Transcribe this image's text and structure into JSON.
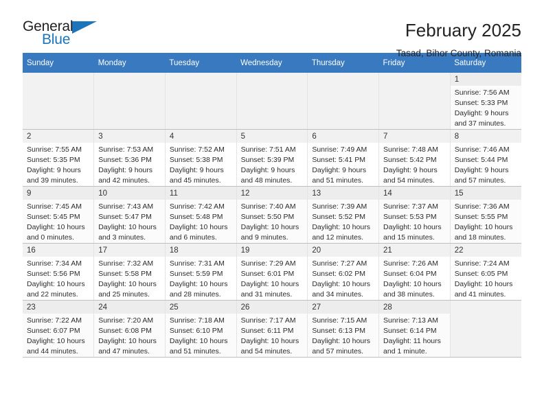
{
  "brand": {
    "name_part1": "General",
    "name_part2": "Blue",
    "triangle_icon": "triangle-icon",
    "colors": {
      "blue": "#1c74bb",
      "dark": "#231f20"
    }
  },
  "header": {
    "title": "February 2025",
    "subtitle": "Tasad, Bihor County, Romania"
  },
  "calendar": {
    "header_bg": "#3879bf",
    "weekdays": [
      "Sunday",
      "Monday",
      "Tuesday",
      "Wednesday",
      "Thursday",
      "Friday",
      "Saturday"
    ],
    "weeks": [
      [
        {
          "day": "",
          "empty": true
        },
        {
          "day": "",
          "empty": true
        },
        {
          "day": "",
          "empty": true
        },
        {
          "day": "",
          "empty": true
        },
        {
          "day": "",
          "empty": true
        },
        {
          "day": "",
          "empty": true
        },
        {
          "day": "1",
          "sunrise": "Sunrise: 7:56 AM",
          "sunset": "Sunset: 5:33 PM",
          "daylight1": "Daylight: 9 hours",
          "daylight2": "and 37 minutes."
        }
      ],
      [
        {
          "day": "2",
          "sunrise": "Sunrise: 7:55 AM",
          "sunset": "Sunset: 5:35 PM",
          "daylight1": "Daylight: 9 hours",
          "daylight2": "and 39 minutes."
        },
        {
          "day": "3",
          "sunrise": "Sunrise: 7:53 AM",
          "sunset": "Sunset: 5:36 PM",
          "daylight1": "Daylight: 9 hours",
          "daylight2": "and 42 minutes."
        },
        {
          "day": "4",
          "sunrise": "Sunrise: 7:52 AM",
          "sunset": "Sunset: 5:38 PM",
          "daylight1": "Daylight: 9 hours",
          "daylight2": "and 45 minutes."
        },
        {
          "day": "5",
          "sunrise": "Sunrise: 7:51 AM",
          "sunset": "Sunset: 5:39 PM",
          "daylight1": "Daylight: 9 hours",
          "daylight2": "and 48 minutes."
        },
        {
          "day": "6",
          "sunrise": "Sunrise: 7:49 AM",
          "sunset": "Sunset: 5:41 PM",
          "daylight1": "Daylight: 9 hours",
          "daylight2": "and 51 minutes."
        },
        {
          "day": "7",
          "sunrise": "Sunrise: 7:48 AM",
          "sunset": "Sunset: 5:42 PM",
          "daylight1": "Daylight: 9 hours",
          "daylight2": "and 54 minutes."
        },
        {
          "day": "8",
          "sunrise": "Sunrise: 7:46 AM",
          "sunset": "Sunset: 5:44 PM",
          "daylight1": "Daylight: 9 hours",
          "daylight2": "and 57 minutes."
        }
      ],
      [
        {
          "day": "9",
          "sunrise": "Sunrise: 7:45 AM",
          "sunset": "Sunset: 5:45 PM",
          "daylight1": "Daylight: 10 hours",
          "daylight2": "and 0 minutes."
        },
        {
          "day": "10",
          "sunrise": "Sunrise: 7:43 AM",
          "sunset": "Sunset: 5:47 PM",
          "daylight1": "Daylight: 10 hours",
          "daylight2": "and 3 minutes."
        },
        {
          "day": "11",
          "sunrise": "Sunrise: 7:42 AM",
          "sunset": "Sunset: 5:48 PM",
          "daylight1": "Daylight: 10 hours",
          "daylight2": "and 6 minutes."
        },
        {
          "day": "12",
          "sunrise": "Sunrise: 7:40 AM",
          "sunset": "Sunset: 5:50 PM",
          "daylight1": "Daylight: 10 hours",
          "daylight2": "and 9 minutes."
        },
        {
          "day": "13",
          "sunrise": "Sunrise: 7:39 AM",
          "sunset": "Sunset: 5:52 PM",
          "daylight1": "Daylight: 10 hours",
          "daylight2": "and 12 minutes."
        },
        {
          "day": "14",
          "sunrise": "Sunrise: 7:37 AM",
          "sunset": "Sunset: 5:53 PM",
          "daylight1": "Daylight: 10 hours",
          "daylight2": "and 15 minutes."
        },
        {
          "day": "15",
          "sunrise": "Sunrise: 7:36 AM",
          "sunset": "Sunset: 5:55 PM",
          "daylight1": "Daylight: 10 hours",
          "daylight2": "and 18 minutes."
        }
      ],
      [
        {
          "day": "16",
          "sunrise": "Sunrise: 7:34 AM",
          "sunset": "Sunset: 5:56 PM",
          "daylight1": "Daylight: 10 hours",
          "daylight2": "and 22 minutes."
        },
        {
          "day": "17",
          "sunrise": "Sunrise: 7:32 AM",
          "sunset": "Sunset: 5:58 PM",
          "daylight1": "Daylight: 10 hours",
          "daylight2": "and 25 minutes."
        },
        {
          "day": "18",
          "sunrise": "Sunrise: 7:31 AM",
          "sunset": "Sunset: 5:59 PM",
          "daylight1": "Daylight: 10 hours",
          "daylight2": "and 28 minutes."
        },
        {
          "day": "19",
          "sunrise": "Sunrise: 7:29 AM",
          "sunset": "Sunset: 6:01 PM",
          "daylight1": "Daylight: 10 hours",
          "daylight2": "and 31 minutes."
        },
        {
          "day": "20",
          "sunrise": "Sunrise: 7:27 AM",
          "sunset": "Sunset: 6:02 PM",
          "daylight1": "Daylight: 10 hours",
          "daylight2": "and 34 minutes."
        },
        {
          "day": "21",
          "sunrise": "Sunrise: 7:26 AM",
          "sunset": "Sunset: 6:04 PM",
          "daylight1": "Daylight: 10 hours",
          "daylight2": "and 38 minutes."
        },
        {
          "day": "22",
          "sunrise": "Sunrise: 7:24 AM",
          "sunset": "Sunset: 6:05 PM",
          "daylight1": "Daylight: 10 hours",
          "daylight2": "and 41 minutes."
        }
      ],
      [
        {
          "day": "23",
          "sunrise": "Sunrise: 7:22 AM",
          "sunset": "Sunset: 6:07 PM",
          "daylight1": "Daylight: 10 hours",
          "daylight2": "and 44 minutes."
        },
        {
          "day": "24",
          "sunrise": "Sunrise: 7:20 AM",
          "sunset": "Sunset: 6:08 PM",
          "daylight1": "Daylight: 10 hours",
          "daylight2": "and 47 minutes."
        },
        {
          "day": "25",
          "sunrise": "Sunrise: 7:18 AM",
          "sunset": "Sunset: 6:10 PM",
          "daylight1": "Daylight: 10 hours",
          "daylight2": "and 51 minutes."
        },
        {
          "day": "26",
          "sunrise": "Sunrise: 7:17 AM",
          "sunset": "Sunset: 6:11 PM",
          "daylight1": "Daylight: 10 hours",
          "daylight2": "and 54 minutes."
        },
        {
          "day": "27",
          "sunrise": "Sunrise: 7:15 AM",
          "sunset": "Sunset: 6:13 PM",
          "daylight1": "Daylight: 10 hours",
          "daylight2": "and 57 minutes."
        },
        {
          "day": "28",
          "sunrise": "Sunrise: 7:13 AM",
          "sunset": "Sunset: 6:14 PM",
          "daylight1": "Daylight: 11 hours",
          "daylight2": "and 1 minute."
        },
        {
          "day": "",
          "empty": true
        }
      ]
    ]
  }
}
